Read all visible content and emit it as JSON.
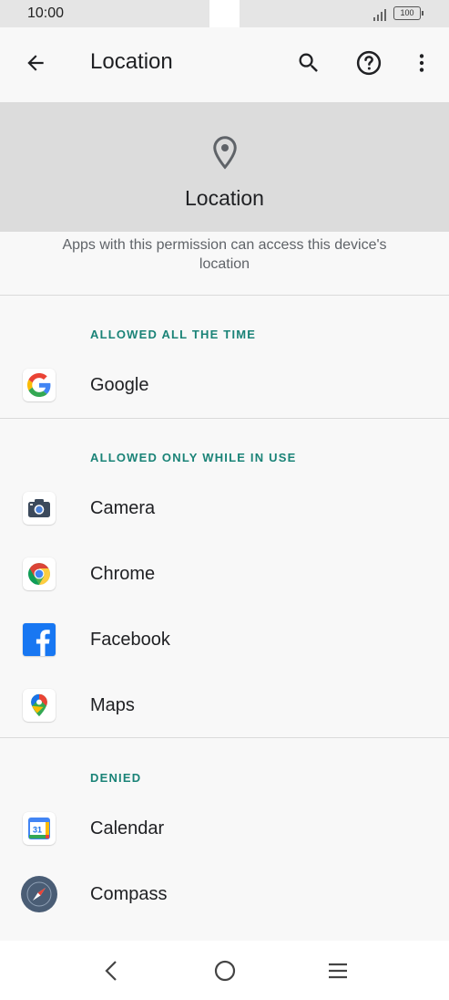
{
  "status_bar": {
    "time": "10:00",
    "battery": "100"
  },
  "app_bar": {
    "title": "Location",
    "icons": [
      "back-arrow-icon",
      "search-icon",
      "help-icon",
      "more-vert-icon"
    ]
  },
  "header": {
    "icon": "location-pin-icon",
    "title": "Location",
    "description": "Apps with this permission can access this device's location"
  },
  "sections": [
    {
      "header": "ALLOWED ALL THE TIME",
      "apps": [
        {
          "name": "Google",
          "icon": "google-icon"
        }
      ]
    },
    {
      "header": "ALLOWED ONLY WHILE IN USE",
      "apps": [
        {
          "name": "Camera",
          "icon": "camera-icon"
        },
        {
          "name": "Chrome",
          "icon": "chrome-icon"
        },
        {
          "name": "Facebook",
          "icon": "facebook-icon"
        },
        {
          "name": "Maps",
          "icon": "maps-icon"
        }
      ]
    },
    {
      "header": "DENIED",
      "apps": [
        {
          "name": "Calendar",
          "icon": "calendar-icon",
          "badge": "31"
        },
        {
          "name": "Compass",
          "icon": "compass-icon"
        }
      ]
    }
  ],
  "colors": {
    "section_header": "#1a8377",
    "header_band": "#dcdcdc",
    "background": "#f8f8f8"
  }
}
